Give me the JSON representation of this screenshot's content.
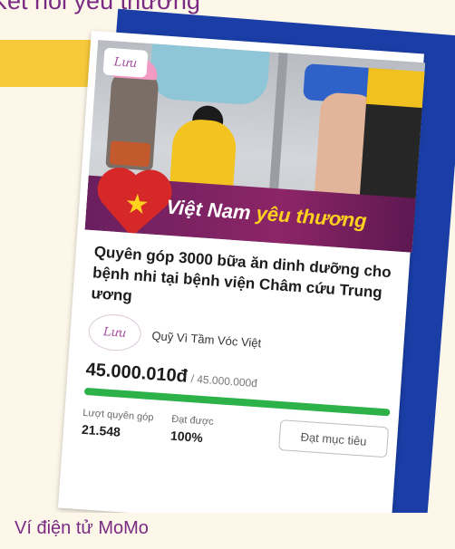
{
  "header_text": "Kết nối yêu thương",
  "card": {
    "photo_logo": "Lưu",
    "banner_part1": "Việt Nam",
    "banner_part2": "yêu thương",
    "title": "Quyên góp 3000 bữa ăn dinh dưỡng cho bệnh nhi tại bệnh viện Châm cứu Trung ương",
    "org_logo": "Lưu",
    "org_name": "Quỹ Vì Tầm Vóc Việt",
    "raised": "45.000.010đ",
    "target": "/ 45.000.000đ",
    "progress": 1.0,
    "stats": [
      {
        "label": "Lượt quyên góp",
        "value": "21.548"
      },
      {
        "label": "Đạt được",
        "value": "100%"
      }
    ],
    "goal_button": "Đạt mục tiêu"
  },
  "caption": "Ví điện tử MoMo",
  "colors": {
    "accent_purple": "#7a2a82",
    "frame_blue": "#1a3ea6",
    "highlight_yellow": "#f6c93b",
    "progress_green": "#2db24a"
  }
}
